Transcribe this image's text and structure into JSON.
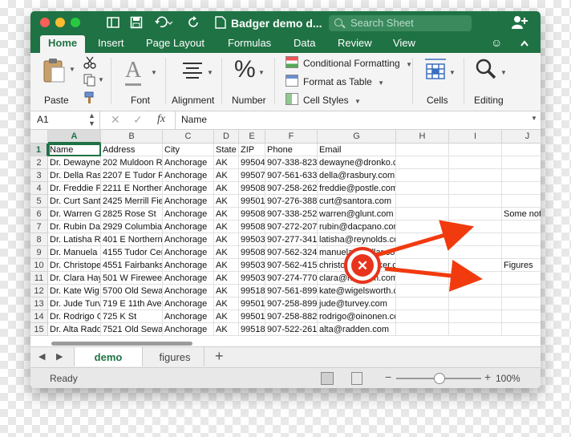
{
  "window": {
    "title": "Badger demo d...",
    "search_placeholder": "Search Sheet"
  },
  "icons": {
    "sidebar": "sidebar-icon",
    "save": "save-icon",
    "undo": "undo-icon",
    "redo": "redo-icon",
    "share": "add-person-icon",
    "smiley": "smiley-icon",
    "collapse": "chevron-up-icon"
  },
  "ribbon_tabs": [
    "Home",
    "Insert",
    "Page Layout",
    "Formulas",
    "Data",
    "Review",
    "View"
  ],
  "ribbon": {
    "paste": "Paste",
    "font": "Font",
    "font_glyph": "A",
    "alignment": "Alignment",
    "number": "Number",
    "number_glyph": "%",
    "conditional_formatting": "Conditional Formatting",
    "format_as_table": "Format as Table",
    "cell_styles": "Cell Styles",
    "cells": "Cells",
    "editing": "Editing"
  },
  "formula_bar": {
    "name_box": "A1",
    "fx": "fx",
    "value": "Name"
  },
  "columns": [
    "A",
    "B",
    "C",
    "D",
    "E",
    "F",
    "G",
    "H",
    "I",
    "J"
  ],
  "rows": [
    {
      "n": "1",
      "cells": [
        "Name",
        "Address",
        "City",
        "State",
        "ZIP",
        "Phone",
        "Email",
        "",
        "",
        ""
      ]
    },
    {
      "n": "2",
      "cells": [
        "Dr. Dewayne",
        "202 Muldoon R",
        "Anchorage",
        "AK",
        "99504",
        "907-338-823",
        "dewayne@dronko.com",
        "",
        "",
        ""
      ]
    },
    {
      "n": "3",
      "cells": [
        "Dr. Della Ras",
        "2207 E Tudor R",
        "Anchorage",
        "AK",
        "99507",
        "907-561-633",
        "della@rasbury.com",
        "",
        "",
        ""
      ]
    },
    {
      "n": "4",
      "cells": [
        "Dr. Freddie P",
        "2211 E Norther",
        "Anchorage",
        "AK",
        "99508",
        "907-258-262",
        "freddie@postle.com",
        "",
        "",
        ""
      ]
    },
    {
      "n": "5",
      "cells": [
        "Dr. Curt Sant",
        "2425 Merrill Fie",
        "Anchorage",
        "AK",
        "99501",
        "907-276-388",
        "curt@santora.com",
        "",
        "",
        ""
      ]
    },
    {
      "n": "6",
      "cells": [
        "Dr. Warren G",
        "2825 Rose St",
        "Anchorage",
        "AK",
        "99508",
        "907-338-252",
        "warren@glunt.com",
        "",
        "",
        "Some notes"
      ]
    },
    {
      "n": "7",
      "cells": [
        "Dr. Rubin Da",
        "2929 Columbia",
        "Anchorage",
        "AK",
        "99508",
        "907-272-207",
        "rubin@dacpano.com",
        "",
        "",
        ""
      ]
    },
    {
      "n": "8",
      "cells": [
        "Dr. Latisha R",
        "401 E Northern",
        "Anchorage",
        "AK",
        "99503",
        "907-277-341",
        "latisha@reynolds.com",
        "",
        "",
        ""
      ]
    },
    {
      "n": "9",
      "cells": [
        "Dr. Manuela",
        "4155 Tudor Cer",
        "Anchorage",
        "AK",
        "99508",
        "907-562-324",
        "manuela@dollar.com",
        "",
        "",
        ""
      ]
    },
    {
      "n": "10",
      "cells": [
        "Dr. Christope",
        "4551 Fairbanks",
        "Anchorage",
        "AK",
        "99503",
        "907-562-415",
        "christoph@becker.com",
        "",
        "",
        "Figures"
      ]
    },
    {
      "n": "11",
      "cells": [
        "Dr. Clara Hay",
        "501 W Fireweed",
        "Anchorage",
        "AK",
        "99503",
        "907-274-770",
        "clara@hayham.com",
        "",
        "",
        ""
      ]
    },
    {
      "n": "12",
      "cells": [
        "Dr. Kate Wig",
        "5700 Old Sewar",
        "Anchorage",
        "AK",
        "99518",
        "907-561-899",
        "kate@wigelsworth.com",
        "",
        "",
        ""
      ]
    },
    {
      "n": "13",
      "cells": [
        "Dr. Jude Turv",
        "719 E 11th Ave",
        "Anchorage",
        "AK",
        "99501",
        "907-258-899",
        "jude@turvey.com",
        "",
        "",
        ""
      ]
    },
    {
      "n": "14",
      "cells": [
        "Dr. Rodrigo C",
        "725 K St",
        "Anchorage",
        "AK",
        "99501",
        "907-258-882",
        "rodrigo@oinonen.com",
        "",
        "",
        ""
      ]
    },
    {
      "n": "15",
      "cells": [
        "Dr. Alta Radd",
        "7521 Old Sewar",
        "Anchorage",
        "AK",
        "99518",
        "907-522-261",
        "alta@radden.com",
        "",
        "",
        ""
      ]
    }
  ],
  "sheet_tabs": [
    "demo",
    "figures"
  ],
  "add_sheet": "+",
  "status": {
    "ready": "Ready",
    "zoom": "100%",
    "zoom_minus": "−",
    "zoom_plus": "+",
    "zoom_level": 0.5
  },
  "overlay": {
    "error_symbol": "✕",
    "arrow_color": "#f23a0f",
    "error_color": "#e8341c"
  }
}
